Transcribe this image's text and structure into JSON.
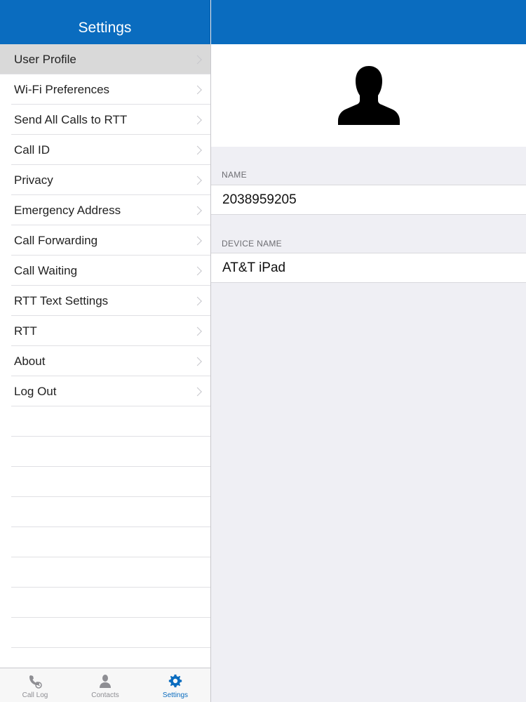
{
  "header": {
    "title": "Settings"
  },
  "sidebar": {
    "items": [
      {
        "label": "User Profile"
      },
      {
        "label": "Wi-Fi Preferences"
      },
      {
        "label": "Send All Calls to RTT"
      },
      {
        "label": "Call ID"
      },
      {
        "label": "Privacy"
      },
      {
        "label": "Emergency Address"
      },
      {
        "label": "Call Forwarding"
      },
      {
        "label": "Call Waiting"
      },
      {
        "label": "RTT Text Settings"
      },
      {
        "label": "RTT"
      },
      {
        "label": "About"
      },
      {
        "label": "Log Out"
      }
    ]
  },
  "profile": {
    "avatar_icon": "person-silhouette-icon",
    "name_label": "NAME",
    "name_value": "2038959205",
    "device_label": "DEVICE NAME",
    "device_value": "AT&T iPad"
  },
  "tabbar": {
    "tabs": [
      {
        "label": "Call Log",
        "icon": "call-log-icon"
      },
      {
        "label": "Contacts",
        "icon": "contacts-icon"
      },
      {
        "label": "Settings",
        "icon": "gear-icon"
      }
    ],
    "active_color": "#0a6cbf",
    "inactive_color": "#8e8e93"
  },
  "colors": {
    "brand": "#0a6cbf",
    "selected_row": "#d9d9d9",
    "background": "#efeff4"
  }
}
